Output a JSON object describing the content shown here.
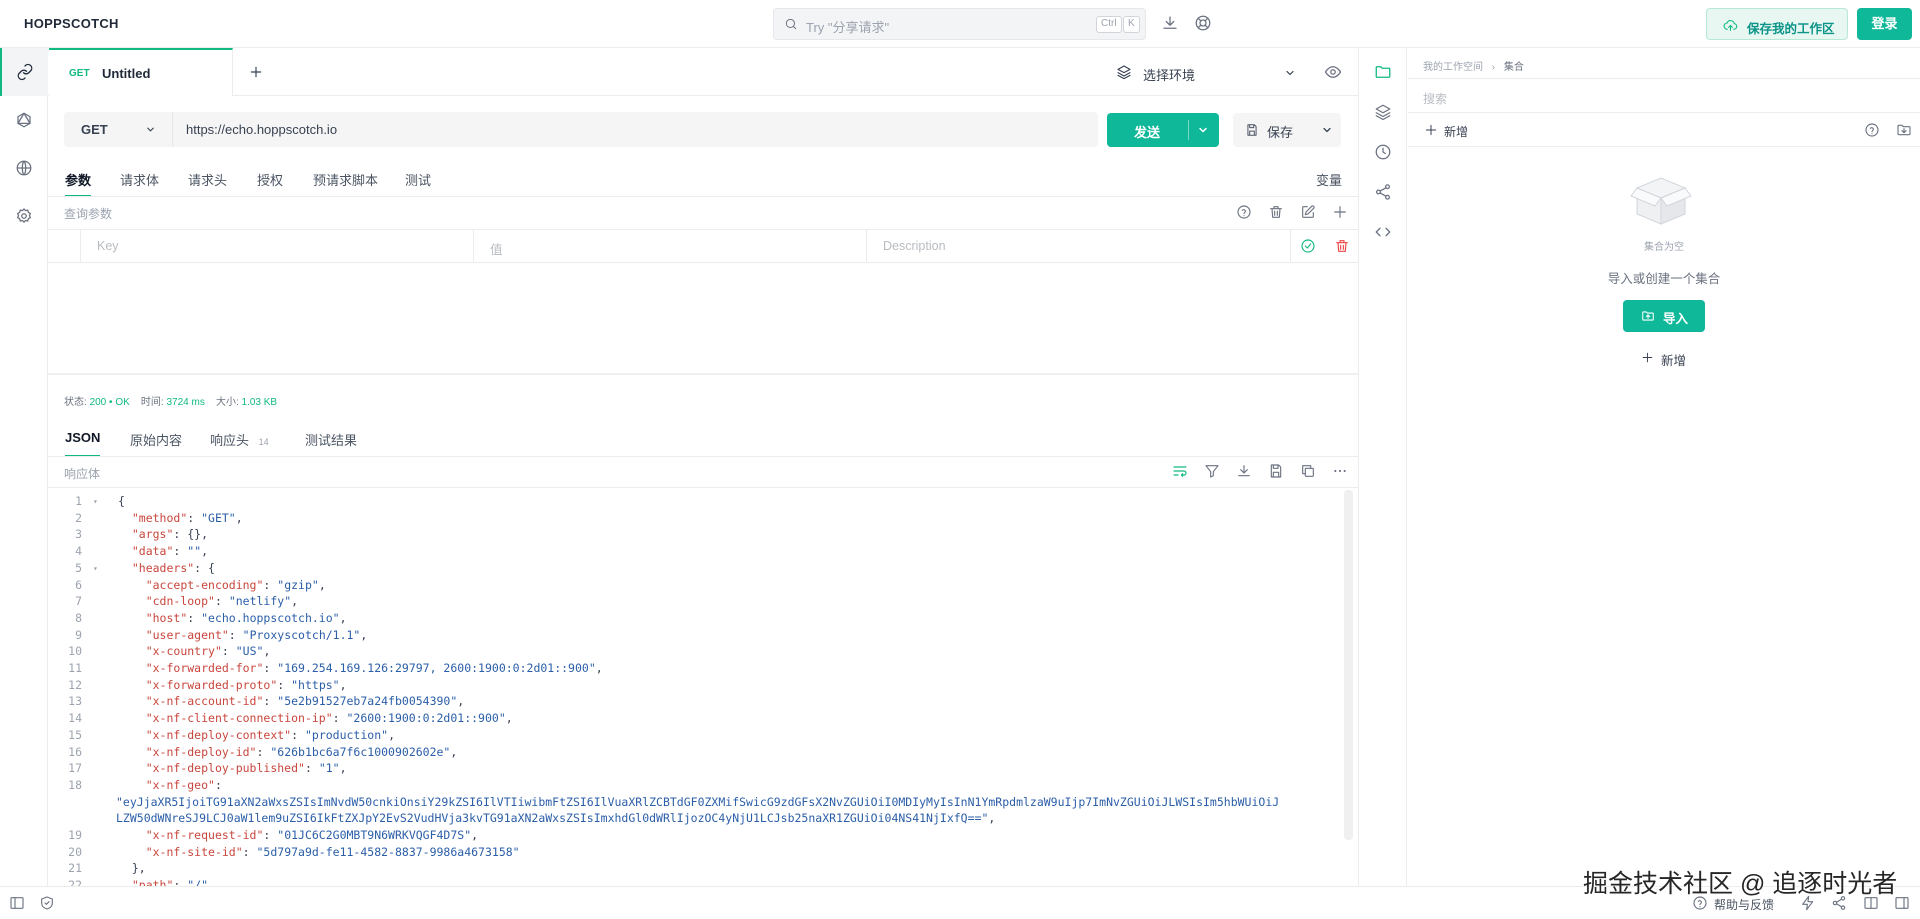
{
  "app": {
    "brand": "HOPPSCOTCH"
  },
  "header": {
    "search_placeholder": "Try \"分享请求\"",
    "kbd_ctrl": "Ctrl",
    "kbd_k": "K",
    "save_workspace_label": "保存我的工作区",
    "login_label": "登录"
  },
  "request_tab": {
    "method": "GET",
    "title": "Untitled"
  },
  "environment": {
    "label": "选择环境"
  },
  "request": {
    "method": "GET",
    "url": "https://echo.hoppscotch.io",
    "send_label": "发送",
    "save_label": "保存"
  },
  "subtabs": {
    "params": "参数",
    "body": "请求体",
    "headers": "请求头",
    "auth": "授权",
    "prerequest": "预请求脚本",
    "tests": "测试",
    "variables": "变量"
  },
  "params": {
    "title": "查询参数",
    "key_placeholder": "Key",
    "value_placeholder": "值",
    "description_placeholder": "Description"
  },
  "status": {
    "status_label": "状态:",
    "status_code": "200",
    "status_text": "OK",
    "time_label": "时间:",
    "time_value": "3724 ms",
    "size_label": "大小:",
    "size_value": "1.03 KB"
  },
  "response_tabs": {
    "json": "JSON",
    "raw": "原始内容",
    "headers": "响应头",
    "headers_count": "14",
    "test_results": "测试结果"
  },
  "response": {
    "title": "响应体",
    "lines": [
      {
        "n": "1",
        "fold": "▾",
        "indent": "",
        "key": "",
        "sep": "{",
        "val": "",
        "tail": ""
      },
      {
        "n": "2",
        "fold": "",
        "indent": "  ",
        "key": "\"method\"",
        "sep": ": ",
        "val": "\"GET\"",
        "tail": ","
      },
      {
        "n": "3",
        "fold": "",
        "indent": "  ",
        "key": "\"args\"",
        "sep": ": {},",
        "val": "",
        "tail": ""
      },
      {
        "n": "4",
        "fold": "",
        "indent": "  ",
        "key": "\"data\"",
        "sep": ": ",
        "val": "\"\"",
        "tail": ","
      },
      {
        "n": "5",
        "fold": "▾",
        "indent": "  ",
        "key": "\"headers\"",
        "sep": ": {",
        "val": "",
        "tail": ""
      },
      {
        "n": "6",
        "fold": "",
        "indent": "    ",
        "key": "\"accept-encoding\"",
        "sep": ": ",
        "val": "\"gzip\"",
        "tail": ","
      },
      {
        "n": "7",
        "fold": "",
        "indent": "    ",
        "key": "\"cdn-loop\"",
        "sep": ": ",
        "val": "\"netlify\"",
        "tail": ","
      },
      {
        "n": "8",
        "fold": "",
        "indent": "    ",
        "key": "\"host\"",
        "sep": ": ",
        "val": "\"echo.hoppscotch.io\"",
        "tail": ","
      },
      {
        "n": "9",
        "fold": "",
        "indent": "    ",
        "key": "\"user-agent\"",
        "sep": ": ",
        "val": "\"Proxyscotch/1.1\"",
        "tail": ","
      },
      {
        "n": "10",
        "fold": "",
        "indent": "    ",
        "key": "\"x-country\"",
        "sep": ": ",
        "val": "\"US\"",
        "tail": ","
      },
      {
        "n": "11",
        "fold": "",
        "indent": "    ",
        "key": "\"x-forwarded-for\"",
        "sep": ": ",
        "val": "\"169.254.169.126:29797, 2600:1900:0:2d01::900\"",
        "tail": ","
      },
      {
        "n": "12",
        "fold": "",
        "indent": "    ",
        "key": "\"x-forwarded-proto\"",
        "sep": ": ",
        "val": "\"https\"",
        "tail": ","
      },
      {
        "n": "13",
        "fold": "",
        "indent": "    ",
        "key": "\"x-nf-account-id\"",
        "sep": ": ",
        "val": "\"5e2b91527eb7a24fb0054390\"",
        "tail": ","
      },
      {
        "n": "14",
        "fold": "",
        "indent": "    ",
        "key": "\"x-nf-client-connection-ip\"",
        "sep": ": ",
        "val": "\"2600:1900:0:2d01::900\"",
        "tail": ","
      },
      {
        "n": "15",
        "fold": "",
        "indent": "    ",
        "key": "\"x-nf-deploy-context\"",
        "sep": ": ",
        "val": "\"production\"",
        "tail": ","
      },
      {
        "n": "16",
        "fold": "",
        "indent": "    ",
        "key": "\"x-nf-deploy-id\"",
        "sep": ": ",
        "val": "\"626b1bc6a7f6c1000902602e\"",
        "tail": ","
      },
      {
        "n": "17",
        "fold": "",
        "indent": "    ",
        "key": "\"x-nf-deploy-published\"",
        "sep": ": ",
        "val": "\"1\"",
        "tail": ","
      },
      {
        "n": "18",
        "fold": "",
        "indent": "    ",
        "key": "\"x-nf-geo\"",
        "sep": ":",
        "val": "",
        "tail": ""
      },
      {
        "n": "",
        "fold": "",
        "indent": "",
        "key": "",
        "sep": "",
        "val": "\"eyJjaXR5IjoiTG91aXN2aWxsZSIsImNvdW50cnkiOnsiY29kZSI6IlVTIiwibmFtZSI6IlVuaXRlZCBTdGF0ZXMifSwicG9zdGFsX2NvZGUiOiI0MDIyMyIsInN1YmRpdmlzaW9uIjp7ImNvZGUiOiJLWSIsIm5hbWUiOiJ",
        "tail": ""
      },
      {
        "n": "",
        "fold": "",
        "indent": "",
        "key": "",
        "sep": "",
        "val": "LZW50dWNreSJ9LCJ0aW1lem9uZSI6IkFtZXJpY2EvS2VudHVja3kvTG91aXN2aWxsZSIsImxhdGl0dWRlIjozOC4yNjU1LCJsb25naXR1ZGUiOi04NS41NjIxfQ==\"",
        "tail": ","
      },
      {
        "n": "19",
        "fold": "",
        "indent": "    ",
        "key": "\"x-nf-request-id\"",
        "sep": ": ",
        "val": "\"01JC6C2G0MBT9N6WRKVQGF4D7S\"",
        "tail": ","
      },
      {
        "n": "20",
        "fold": "",
        "indent": "    ",
        "key": "\"x-nf-site-id\"",
        "sep": ": ",
        "val": "\"5d797a9d-fe11-4582-8837-9986a4673158\"",
        "tail": ""
      },
      {
        "n": "21",
        "fold": "",
        "indent": "  ",
        "key": "",
        "sep": "},",
        "val": "",
        "tail": ""
      },
      {
        "n": "22",
        "fold": "",
        "indent": "  ",
        "key": "\"path\"",
        "sep": ": ",
        "val": "\"/\"",
        "tail": ","
      }
    ]
  },
  "collections": {
    "breadcrumb_workspace": "我的工作空间",
    "breadcrumb_collections": "集合",
    "search_placeholder": "搜索",
    "new_label": "新增",
    "empty_label": "集合为空",
    "hint": "导入或创建一个集合",
    "import_label": "导入",
    "new_button_label": "新增"
  },
  "footer": {
    "help_label": "帮助与反馈"
  },
  "watermark": "掘金技术社区 @ 追逐时光者",
  "colors": {
    "accent": "#10b89a",
    "json_key": "#c9463d",
    "json_string": "#2b5ea8"
  }
}
